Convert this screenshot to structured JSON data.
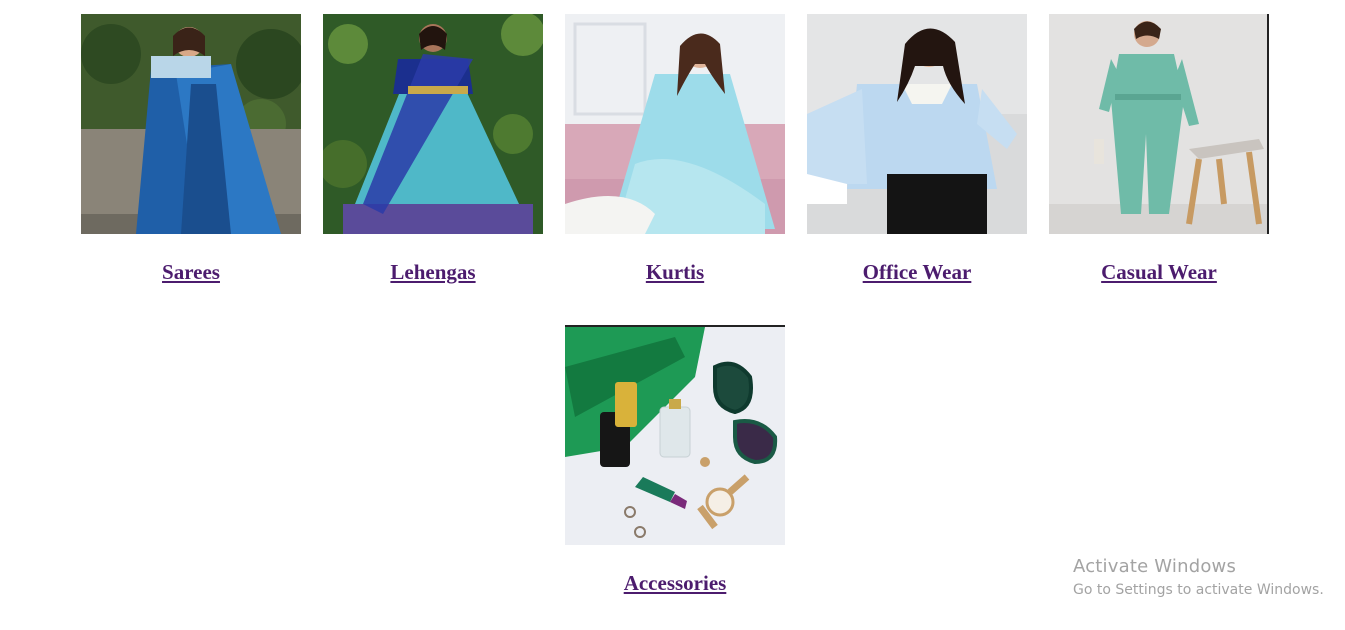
{
  "categories": [
    {
      "label": "Sarees",
      "image_icon": "saree-photo"
    },
    {
      "label": "Lehengas",
      "image_icon": "lehenga-photo"
    },
    {
      "label": "Kurtis",
      "image_icon": "kurti-photo"
    },
    {
      "label": "Office Wear",
      "image_icon": "office-wear-photo"
    },
    {
      "label": "Casual Wear",
      "image_icon": "casual-wear-photo"
    },
    {
      "label": "Accessories",
      "image_icon": "accessories-photo"
    }
  ],
  "watermark": {
    "title": "Activate Windows",
    "subtitle": "Go to Settings to activate Windows."
  },
  "colors": {
    "link": "#4c1c6e",
    "background": "#ffffff",
    "watermark": "#a3a3a3"
  }
}
